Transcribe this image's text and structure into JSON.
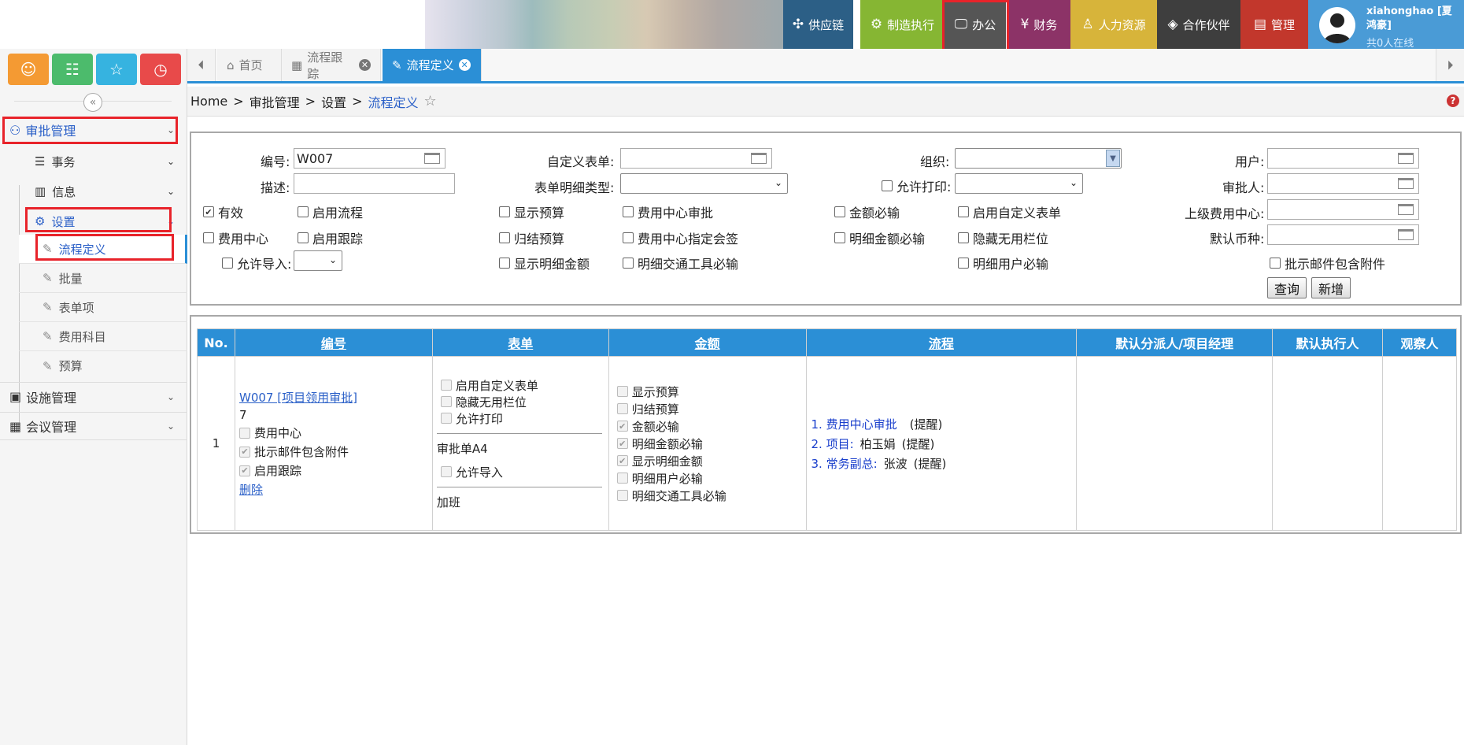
{
  "header": {
    "nav": [
      {
        "label": "供应链",
        "icon": "network-icon",
        "color": "#2c5f86"
      },
      {
        "label": "制造执行",
        "icon": "gear-hand-icon",
        "color": "#86b633"
      },
      {
        "label": "办公",
        "icon": "monitor-icon",
        "color": "#555555"
      },
      {
        "label": "财务",
        "icon": "money-icon",
        "color": "#8c3367"
      },
      {
        "label": "人力资源",
        "icon": "person-icon",
        "color": "#d7b43a"
      },
      {
        "label": "合作伙伴",
        "icon": "diamond-icon",
        "color": "#3e3e3e"
      },
      {
        "label": "管理",
        "icon": "clipboard-icon",
        "color": "#c2372c"
      }
    ],
    "user": {
      "name": "xiahonghao [夏鸿豪]",
      "online": "共0人在线",
      "bg": "#4a9bd6"
    }
  },
  "sidebar": {
    "quick_buttons": [
      {
        "icon": "user-icon",
        "color": "#f49a33"
      },
      {
        "icon": "list-icon",
        "color": "#4cbb6c"
      },
      {
        "icon": "star-icon",
        "color": "#36b3e0"
      },
      {
        "icon": "history-icon",
        "color": "#e84a4a"
      }
    ],
    "sections": [
      {
        "label": "审批管理"
      },
      {
        "label": "设施管理"
      },
      {
        "label": "会议管理"
      }
    ],
    "subs": [
      {
        "label": "事务"
      },
      {
        "label": "信息"
      },
      {
        "label": "设置"
      }
    ],
    "leaves": [
      {
        "label": "流程定义"
      },
      {
        "label": "批量"
      },
      {
        "label": "表单项"
      },
      {
        "label": "费用科目"
      },
      {
        "label": "预算"
      }
    ]
  },
  "tabs": [
    {
      "label": "首页"
    },
    {
      "label": "流程跟踪"
    },
    {
      "label": "流程定义"
    }
  ],
  "breadcrumb": {
    "home": "Home",
    "sep": ">",
    "l1": "审批管理",
    "l2": "设置",
    "current": "流程定义"
  },
  "filter": {
    "labels": {
      "code": "编号:",
      "custom_form": "自定义表单:",
      "org": "组织:",
      "user": "用户:",
      "desc": "描述:",
      "detail_type": "表单明细类型:",
      "allow_print": "允许打印:",
      "approver": "审批人:",
      "parent_cc": "上级费用中心:",
      "currency": "默认币种:",
      "allow_import": "允许导入:"
    },
    "code_value": "W007",
    "checkboxes": {
      "valid": "有效",
      "enable_flow": "启用流程",
      "show_budget": "显示预算",
      "cc_approval": "费用中心审批",
      "amount_required": "金额必输",
      "enable_custom_form": "启用自定义表单",
      "cost_center": "费用中心",
      "enable_tracking": "启用跟踪",
      "close_budget": "归结预算",
      "cc_cosign": "费用中心指定会签",
      "detail_amount_required": "明细金额必输",
      "hide_unused": "隐藏无用栏位",
      "show_detail_amount": "显示明细金额",
      "detail_transport_required": "明细交通工具必输",
      "detail_user_required": "明细用户必输",
      "mail_attachment": "批示邮件包含附件"
    },
    "buttons": {
      "query": "查询",
      "add": "新增"
    }
  },
  "table": {
    "headers": [
      "No.",
      "编号",
      "表单",
      "金额",
      "流程",
      "默认分派人/项目经理",
      "默认执行人",
      "观察人"
    ],
    "row": {
      "no": "1",
      "code_link": "W007 [项目领用审批]",
      "code_num": "7",
      "code_checks": [
        {
          "label": "费用中心",
          "on": false
        },
        {
          "label": "批示邮件包含附件",
          "on": true
        },
        {
          "label": "启用跟踪",
          "on": true
        }
      ],
      "delete": "删除",
      "form_checks": [
        {
          "label": "启用自定义表单",
          "on": false
        },
        {
          "label": "隐藏无用栏位",
          "on": false
        },
        {
          "label": "允许打印",
          "on": false
        }
      ],
      "form_name": "审批单A4",
      "form_import": "允许导入",
      "form_extra": "加班",
      "amount_checks": [
        {
          "label": "显示预算",
          "on": false
        },
        {
          "label": "归结预算",
          "on": false
        },
        {
          "label": "金额必输",
          "on": true
        },
        {
          "label": "明细金额必输",
          "on": true
        },
        {
          "label": "显示明细金额",
          "on": true
        },
        {
          "label": "明细用户必输",
          "on": false
        },
        {
          "label": "明细交通工具必输",
          "on": false
        }
      ],
      "flow": [
        {
          "step": "1. 费用中心审批",
          "person": "",
          "note": "(提醒)"
        },
        {
          "step": "2. 项目:",
          "person": "柏玉娟",
          "note": "(提醒)"
        },
        {
          "step": "3. 常务副总:",
          "person": "张波",
          "note": "(提醒)"
        }
      ]
    }
  }
}
